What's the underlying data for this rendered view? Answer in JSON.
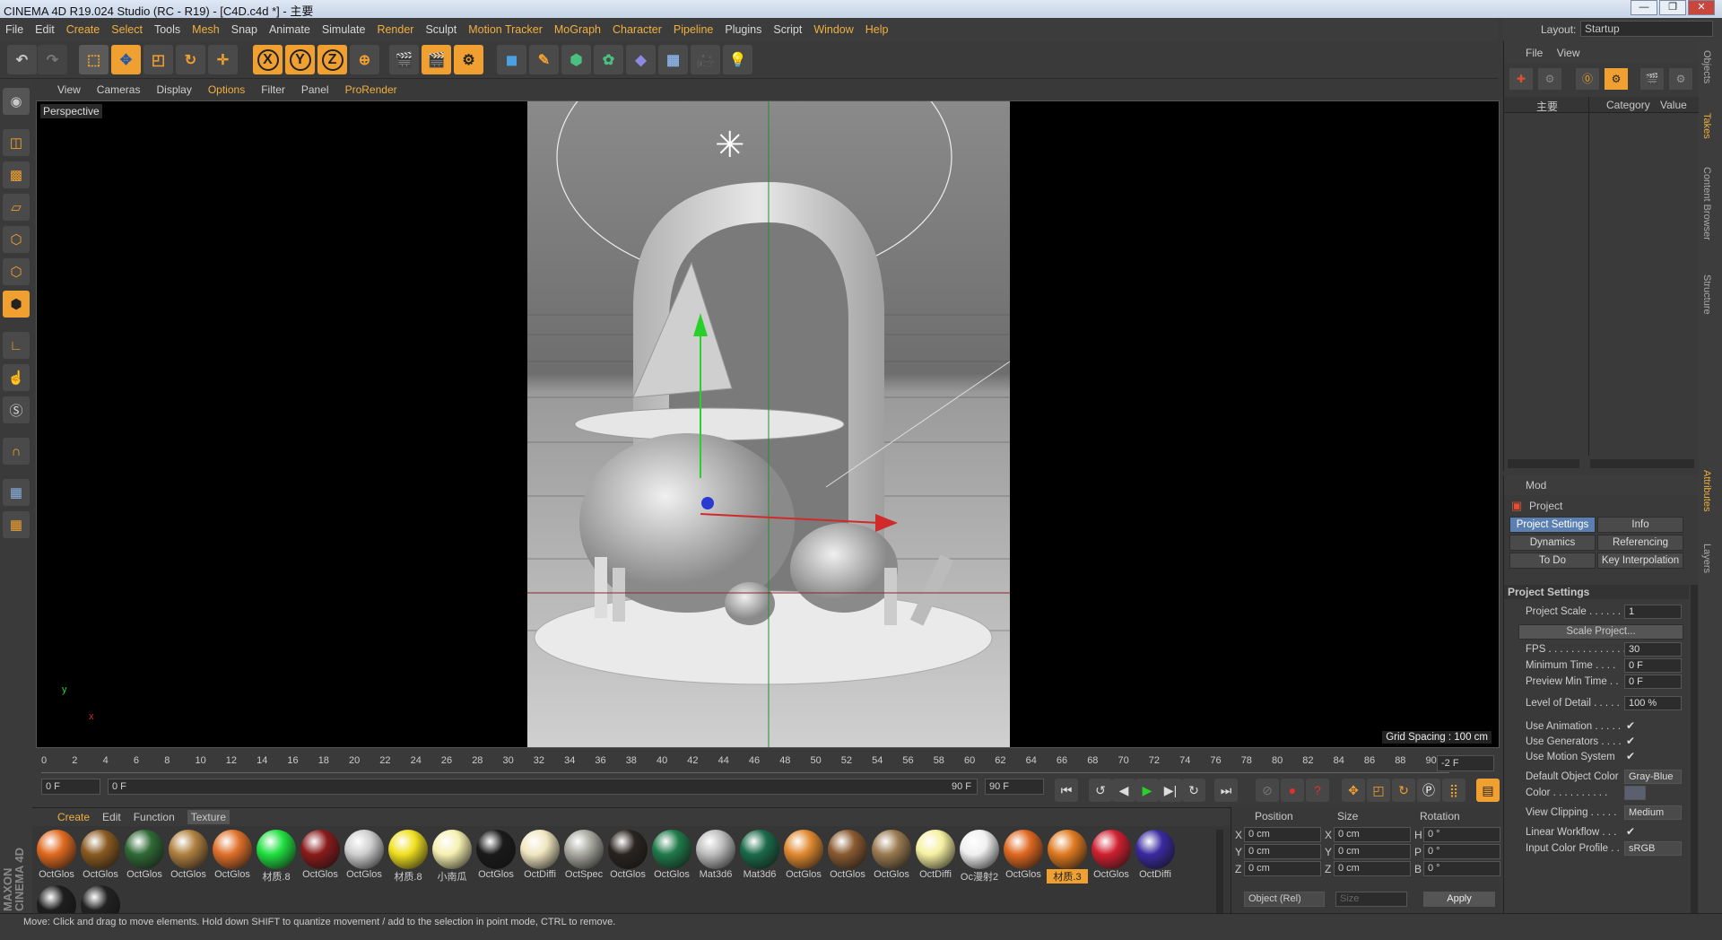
{
  "window": {
    "title": "CINEMA 4D R19.024 Studio (RC - R19) - [C4D.c4d *] - 主要"
  },
  "menu": [
    "File",
    "Edit",
    "Create",
    "Select",
    "Tools",
    "Mesh",
    "Snap",
    "Animate",
    "Simulate",
    "Render",
    "Sculpt",
    "Motion Tracker",
    "MoGraph",
    "Character",
    "Pipeline",
    "Plugins",
    "Script",
    "Window",
    "Help"
  ],
  "menu_highlighted": [
    "Create",
    "Select",
    "Mesh",
    "Render",
    "Motion Tracker",
    "MoGraph",
    "Character",
    "Pipeline",
    "Window",
    "Help"
  ],
  "layout": {
    "label": "Layout:",
    "value": "Startup"
  },
  "toolbar_axes": [
    "X",
    "Y",
    "Z"
  ],
  "viewport_menu": [
    "View",
    "Cameras",
    "Display",
    "Options",
    "Filter",
    "Panel",
    "ProRender"
  ],
  "viewport_menu_highlighted": [
    "Options",
    "ProRender"
  ],
  "viewport": {
    "label": "Perspective",
    "grid_spacing": "Grid Spacing : 100 cm",
    "axis_y": "y",
    "axis_x": "x"
  },
  "timeline": {
    "ticks": [
      "0",
      "2",
      "4",
      "6",
      "8",
      "10",
      "12",
      "14",
      "16",
      "18",
      "20",
      "22",
      "24",
      "26",
      "28",
      "30",
      "32",
      "34",
      "36",
      "38",
      "40",
      "42",
      "44",
      "46",
      "48",
      "50",
      "52",
      "54",
      "56",
      "58",
      "60",
      "62",
      "64",
      "66",
      "68",
      "70",
      "72",
      "74",
      "76",
      "78",
      "80",
      "82",
      "84",
      "86",
      "88",
      "90"
    ],
    "current_frame": "-2 F",
    "start_field": "0 F",
    "range_start": "0 F",
    "range_end": "90 F",
    "end_field": "90 F"
  },
  "materials": {
    "menu": [
      "Create",
      "Edit",
      "Function",
      "Texture"
    ],
    "items": [
      {
        "label": "OctGlos",
        "color": "#e06a20"
      },
      {
        "label": "OctGlos",
        "color": "#8a5a20"
      },
      {
        "label": "OctGlos",
        "color": "#2f6a35"
      },
      {
        "label": "OctGlos",
        "color": "#b08040"
      },
      {
        "label": "OctGlos",
        "color": "#e0702a"
      },
      {
        "label": "材质.8",
        "color": "#20e040"
      },
      {
        "label": "OctGlos",
        "color": "#8a1a1a"
      },
      {
        "label": "OctGlos",
        "color": "#cfcfcf"
      },
      {
        "label": "材质.8",
        "color": "#f0e020"
      },
      {
        "label": "小南瓜",
        "color": "#f6f0b0"
      },
      {
        "label": "OctGlos",
        "color": "#1a1a1a"
      },
      {
        "label": "OctDiffi",
        "color": "#f0e6c0"
      },
      {
        "label": "OctSpec",
        "color": "#a8a8a0"
      },
      {
        "label": "OctGlos",
        "color": "#2a2420"
      },
      {
        "label": "OctGlos",
        "color": "#1f7a4a"
      },
      {
        "label": "Mat3d6",
        "color": "#bdbdbd"
      },
      {
        "label": "Mat3d6",
        "color": "#1a6a4a"
      },
      {
        "label": "OctGlos",
        "color": "#e08a30"
      },
      {
        "label": "OctGlos",
        "color": "#8a5a30"
      },
      {
        "label": "OctGlos",
        "color": "#9a7a50"
      },
      {
        "label": "OctDiffi",
        "color": "#f6f0a0"
      },
      {
        "label": "Oc漫射2",
        "color": "#f0f0f0"
      },
      {
        "label": "OctGlos",
        "color": "#e06820"
      },
      {
        "label": "材质.3",
        "color": "#e07a20",
        "selected": true
      },
      {
        "label": "OctGlos",
        "color": "#d02030"
      },
      {
        "label": "OctDiffi",
        "color": "#3a2aa0"
      },
      {
        "label": "",
        "color": "#1e1e1e"
      },
      {
        "label": "",
        "color": "#222222"
      }
    ]
  },
  "coords": {
    "headers": [
      "Position",
      "Size",
      "Rotation"
    ],
    "rows": [
      {
        "axis": "X",
        "pos": "0 cm",
        "saxis": "X",
        "size": "0 cm",
        "raxis": "H",
        "rot": "0 °"
      },
      {
        "axis": "Y",
        "pos": "0 cm",
        "saxis": "Y",
        "size": "0 cm",
        "raxis": "P",
        "rot": "0 °"
      },
      {
        "axis": "Z",
        "pos": "0 cm",
        "saxis": "Z",
        "size": "0 cm",
        "raxis": "B",
        "rot": "0 °"
      }
    ],
    "mode": "Object (Rel)",
    "size_mode": "Size",
    "apply": "Apply"
  },
  "status": "Move: Click and drag to move elements. Hold down SHIFT to quantize movement / add to the selection in point mode, CTRL to remove.",
  "maxon": "MAXON CINEMA 4D",
  "objects": {
    "menu": [
      "File",
      "View"
    ],
    "col_name": "主要",
    "col_category": "Category",
    "col_value": "Value"
  },
  "right_tabs": [
    "Objects",
    "Takes",
    "Content Browser",
    "Structure",
    "Attributes",
    "Layers"
  ],
  "attributes": {
    "mode": "Mod",
    "title": "Project",
    "tabs": [
      "Project Settings",
      "Info",
      "Dynamics",
      "Referencing",
      "To Do",
      "Key Interpolation"
    ],
    "section": "Project Settings",
    "rows": [
      {
        "label": "Project Scale . . . . . .",
        "value": "1"
      },
      {
        "label": "FPS . . . . . . . . . . . . . . .",
        "value": "30"
      },
      {
        "label": "Minimum Time . . . .",
        "value": "0 F"
      },
      {
        "label": "Preview Min Time . .",
        "value": "0 F"
      },
      {
        "label": "Level of Detail . . . . .",
        "value": "100 %"
      },
      {
        "label": "Use Animation . . . . .",
        "value": "✔"
      },
      {
        "label": "Use Generators . . . .",
        "value": "✔"
      },
      {
        "label": "Use Motion System",
        "value": "✔"
      },
      {
        "label": "Default Object Color",
        "value": "Gray-Blue"
      },
      {
        "label": "Color . . . . . . . . . .",
        "value": ""
      },
      {
        "label": "View Clipping . . . . .",
        "value": "Medium"
      },
      {
        "label": "Linear Workflow . . .",
        "value": "✔"
      },
      {
        "label": "Input Color Profile . .",
        "value": "sRGB"
      }
    ],
    "scale_button": "Scale Project..."
  }
}
